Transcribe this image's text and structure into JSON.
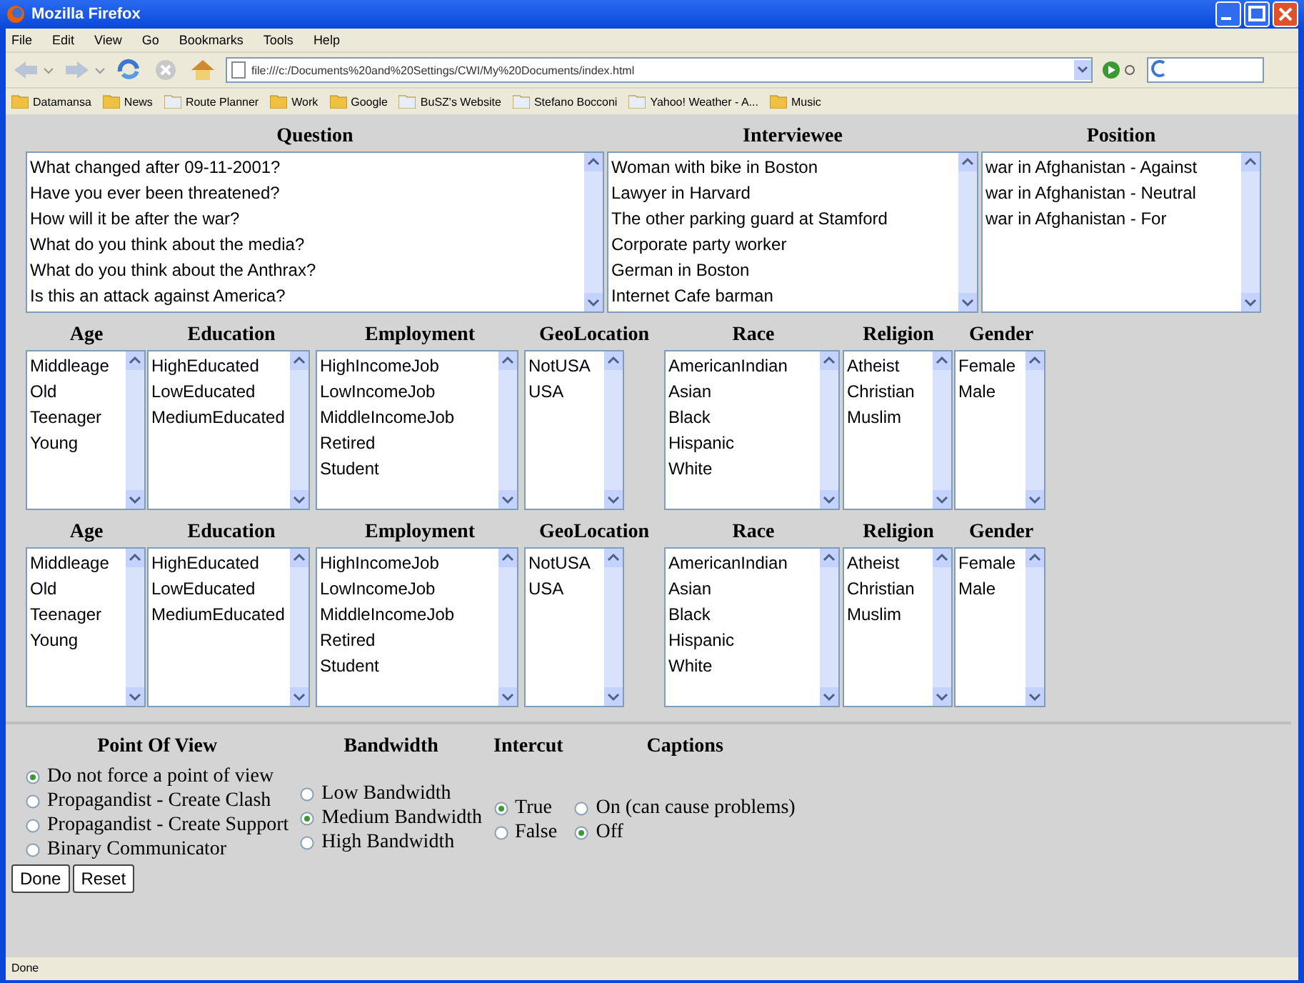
{
  "window": {
    "title": "Mozilla Firefox"
  },
  "menu": [
    "File",
    "Edit",
    "View",
    "Go",
    "Bookmarks",
    "Tools",
    "Help"
  ],
  "address": {
    "value": "file:///c:/Documents%20and%20Settings/CWI/My%20Documents/index.html"
  },
  "bookmarks": [
    "Datamansa",
    "News",
    "Route Planner",
    "Work",
    "Google",
    "BuSZ's Website",
    "Stefano Bocconi",
    "Yahoo! Weather - A...",
    "Music"
  ],
  "top_lists": [
    {
      "heading": "Question",
      "options": [
        "What changed after 09-11-2001?",
        "Have you ever been threatened?",
        "How will it be after the war?",
        "What do you think about the media?",
        "What do you think about the Anthrax?",
        "Is this an attack against America?"
      ]
    },
    {
      "heading": "Interviewee",
      "options": [
        "Woman with bike in Boston",
        "Lawyer in Harvard",
        "The other parking guard at Stamford",
        "Corporate party worker",
        "German in Boston",
        "Internet Cafe barman"
      ]
    },
    {
      "heading": "Position",
      "options": [
        "war in Afghanistan - Against",
        "war in Afghanistan - Neutral",
        "war in Afghanistan - For"
      ]
    }
  ],
  "profile_groups": [
    [
      {
        "heading": "Age",
        "options": [
          "Middleage",
          "Old",
          "Teenager",
          "Young"
        ]
      },
      {
        "heading": "Education",
        "options": [
          "HighEducated",
          "LowEducated",
          "MediumEducated"
        ]
      },
      {
        "heading": "Employment",
        "options": [
          "HighIncomeJob",
          "LowIncomeJob",
          "MiddleIncomeJob",
          "Retired",
          "Student"
        ]
      },
      {
        "heading": "GeoLocation",
        "options": [
          "NotUSA",
          "USA"
        ]
      },
      {
        "heading": "Race",
        "options": [
          "AmericanIndian",
          "Asian",
          "Black",
          "Hispanic",
          "White"
        ]
      },
      {
        "heading": "Religion",
        "options": [
          "Atheist",
          "Christian",
          "Muslim"
        ]
      },
      {
        "heading": "Gender",
        "options": [
          "Female",
          "Male"
        ]
      }
    ],
    [
      {
        "heading": "Age",
        "options": [
          "Middleage",
          "Old",
          "Teenager",
          "Young"
        ]
      },
      {
        "heading": "Education",
        "options": [
          "HighEducated",
          "LowEducated",
          "MediumEducated"
        ]
      },
      {
        "heading": "Employment",
        "options": [
          "HighIncomeJob",
          "LowIncomeJob",
          "MiddleIncomeJob",
          "Retired",
          "Student"
        ]
      },
      {
        "heading": "GeoLocation",
        "options": [
          "NotUSA",
          "USA"
        ]
      },
      {
        "heading": "Race",
        "options": [
          "AmericanIndian",
          "Asian",
          "Black",
          "Hispanic",
          "White"
        ]
      },
      {
        "heading": "Religion",
        "options": [
          "Atheist",
          "Christian",
          "Muslim"
        ]
      },
      {
        "heading": "Gender",
        "options": [
          "Female",
          "Male"
        ]
      }
    ]
  ],
  "radio_groups": [
    {
      "heading": "Point Of View",
      "options": [
        {
          "label": "Do not force a point of view",
          "selected": true
        },
        {
          "label": "Propagandist - Create Clash",
          "selected": false
        },
        {
          "label": "Propagandist - Create Support",
          "selected": false
        },
        {
          "label": "Binary Communicator",
          "selected": false
        }
      ]
    },
    {
      "heading": "Bandwidth",
      "options": [
        {
          "label": "Low Bandwidth",
          "selected": false
        },
        {
          "label": "Medium Bandwidth",
          "selected": true
        },
        {
          "label": "High Bandwidth",
          "selected": false
        }
      ]
    },
    {
      "heading": "Intercut",
      "options": [
        {
          "label": "True",
          "selected": true
        },
        {
          "label": "False",
          "selected": false
        }
      ]
    },
    {
      "heading": "Captions",
      "options": [
        {
          "label": "On (can cause problems)",
          "selected": false
        },
        {
          "label": "Off",
          "selected": true
        }
      ]
    }
  ],
  "buttons": [
    "Done",
    "Reset"
  ],
  "status_bar": "Done"
}
